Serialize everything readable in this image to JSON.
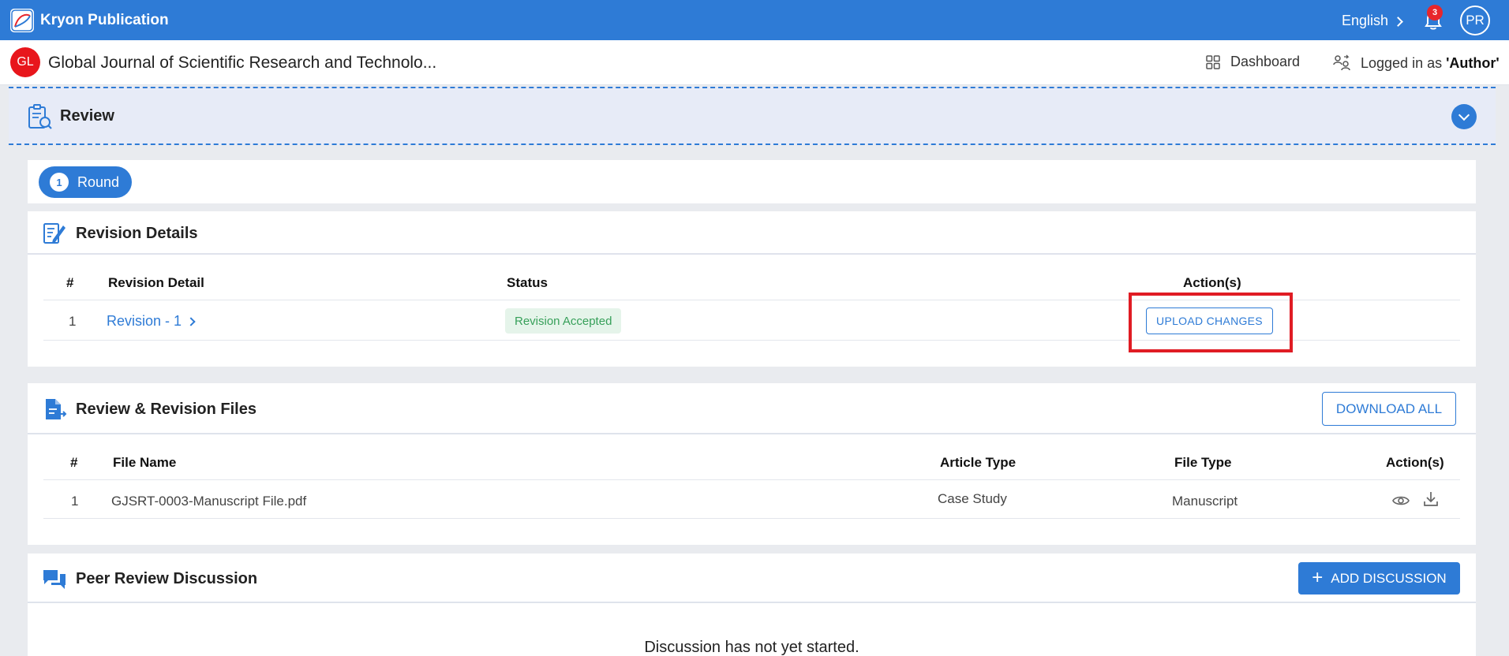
{
  "topbar": {
    "brand_name": "Kryon Publication",
    "language": "English",
    "notification_count": "3",
    "avatar_initials": "PR"
  },
  "journal": {
    "logo_initials": "GL",
    "title": "Global Journal of Scientific Research and Technolo...",
    "dashboard_label": "Dashboard",
    "logged_in_prefix": "Logged in as ",
    "logged_in_role": "'Author'"
  },
  "review": {
    "title": "Review",
    "round": {
      "number": "1",
      "label": "Round"
    }
  },
  "revision_details": {
    "title": "Revision Details",
    "columns": [
      "#",
      "Revision Detail",
      "Status",
      "Action(s)"
    ],
    "rows": [
      {
        "index": "1",
        "detail": "Revision - 1",
        "status": "Revision Accepted",
        "action": "UPLOAD CHANGES"
      }
    ]
  },
  "files": {
    "title": "Review & Revision Files",
    "download_all": "DOWNLOAD ALL",
    "columns": [
      "#",
      "File Name",
      "Article Type",
      "File Type",
      "Action(s)"
    ],
    "rows": [
      {
        "index": "1",
        "file_name": "GJSRT-0003-Manuscript File.pdf",
        "article_type": "Case Study",
        "file_type": "Manuscript"
      }
    ]
  },
  "discussion": {
    "title": "Peer Review Discussion",
    "add_label": "ADD DISCUSSION",
    "empty_message": "Discussion has not yet started."
  },
  "colors": {
    "primary": "#2e7bd6",
    "highlight": "#e01c24",
    "accepted_text": "#37a05a",
    "accepted_bg": "#e5f4ea"
  }
}
